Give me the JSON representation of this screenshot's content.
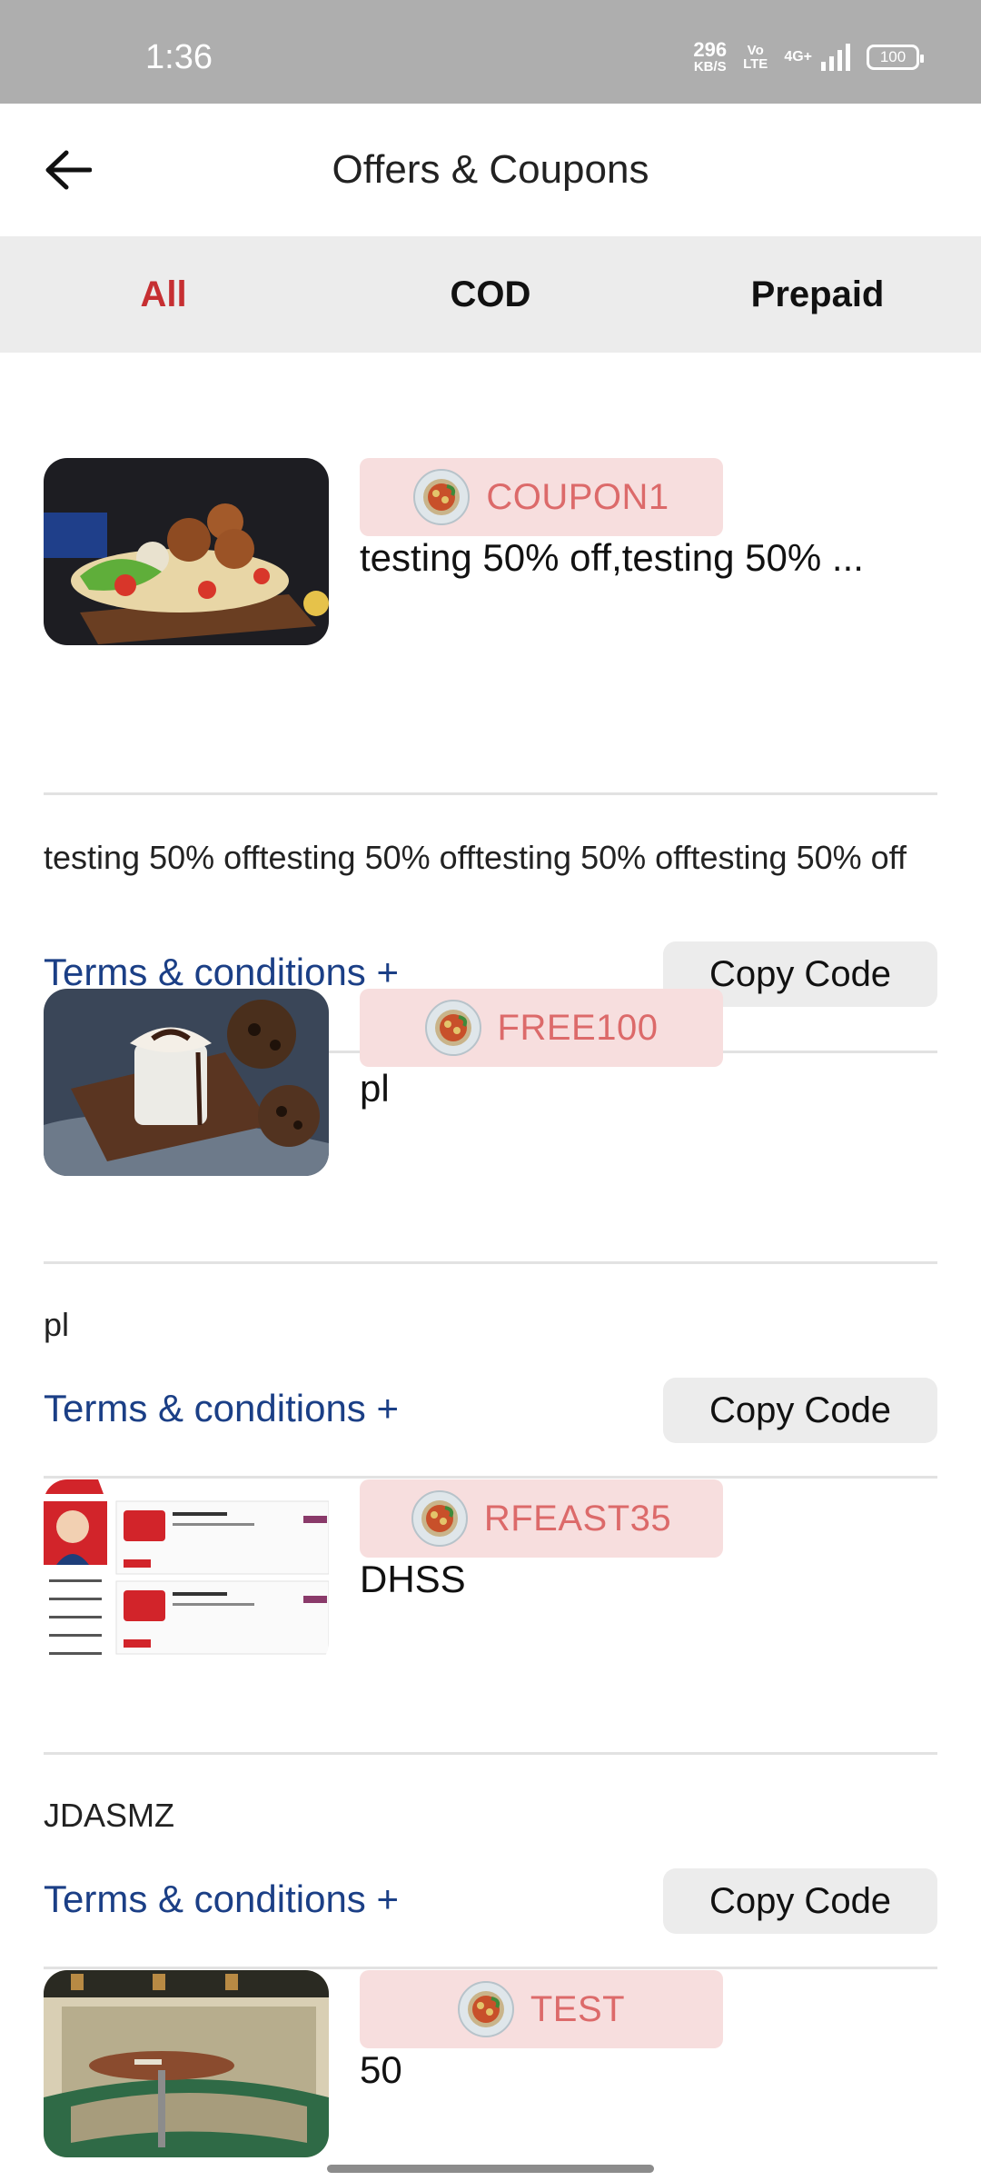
{
  "status_bar": {
    "time": "1:36",
    "speed_value": "296",
    "speed_unit": "KB/S",
    "volte_line1": "Vo",
    "volte_line2": "LTE",
    "network": "4G+",
    "battery": "100"
  },
  "header": {
    "title": "Offers & Coupons",
    "back_icon": "arrow-left-icon"
  },
  "tabs": [
    {
      "label": "All",
      "active": true
    },
    {
      "label": "COD",
      "active": false
    },
    {
      "label": "Prepaid",
      "active": false
    }
  ],
  "offers": [
    {
      "code": "COUPON1",
      "title": "testing 50% off,testing 50% ...",
      "description": "testing 50% offtesting 50% offtesting 50% offtesting 50% off",
      "terms_label": "Terms & conditions +",
      "copy_label": "Copy Code",
      "image": "falafel-wrap-photo"
    },
    {
      "code": "FREE100",
      "title": "pl",
      "description": "pl",
      "terms_label": "Terms & conditions +",
      "copy_label": "Copy Code",
      "image": "hot-chocolate-cookies-photo"
    },
    {
      "code": "RFEAST35",
      "title": "DHSS",
      "description": "JDASMZ",
      "terms_label": "Terms & conditions +",
      "copy_label": "Copy Code",
      "image": "dashboard-screenshot"
    },
    {
      "code": "TEST",
      "title": "50",
      "image": "restaurant-booth-photo"
    }
  ],
  "colors": {
    "accent": "#c62f32",
    "badge_bg": "#f7dede",
    "badge_text": "#dc6a6a",
    "terms_link": "#1b3f86",
    "tab_bg": "#ececec",
    "status_bar": "#aeaeae"
  }
}
